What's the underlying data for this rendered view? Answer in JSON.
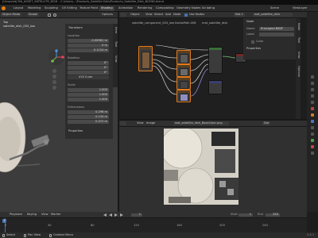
{
  "window": {
    "title": "[Unsaved] MA_ASSET_SATELLITE_DISH - C:\\Users\\...\\Products_Satellite Dish\\Products_Satellite_Dish_BLEND.blend"
  },
  "menubar": {
    "items": [
      "Layout",
      "Modeling",
      "Sculpting",
      "UV Editing",
      "Texture Paint",
      "Shading",
      "Animation",
      "Rendering",
      "Compositing",
      "Geometry Nodes",
      "Scripting"
    ],
    "active_index": 5,
    "scene_label": "Scene",
    "view_layer_label": "ViewLayer"
  },
  "viewport": {
    "mode": "Object Mode",
    "orientation": "Global",
    "view_label": "Top",
    "object_label": "satellite_dish_003_low",
    "options_label": "Options"
  },
  "n_panel": {
    "section_title": "Transform",
    "location_label": "Location",
    "location": {
      "x": "-0.08981 m",
      "y": "0 m",
      "z": "0.1154 m"
    },
    "rotation_label": "Rotation",
    "rotation": {
      "x": "0°",
      "y": "0°",
      "z": "0°"
    },
    "rotation_mode": "XYZ Euler",
    "scale_label": "Scale",
    "scale": {
      "x": "1.000",
      "y": "1.000",
      "z": "1.000"
    },
    "dimensions_label": "Dimensions",
    "dimensions": {
      "x": "0.296 m",
      "y": "0.134 m",
      "z": "0.372 m"
    },
    "properties_label": "Properties",
    "tabs": [
      "Item",
      "Tool",
      "View"
    ]
  },
  "node_editor": {
    "header_items": [
      "Object",
      "View",
      "Select",
      "Add",
      "Node"
    ],
    "use_nodes_label": "Use Nodes",
    "slot_label": "Slot 1",
    "material_name": "mat_satellite_dish",
    "breadcrumb": [
      "satellite_component_003_low",
      "NurbsPath.008",
      "mat_satellite_dish"
    ],
    "side_tabs": [
      "Node",
      "Tool",
      "View",
      "Options"
    ]
  },
  "node_sidebar": {
    "section_title": "Node",
    "name_label": "Name",
    "name_value": "Principled BSDF",
    "label_label": "Label",
    "label_value": "",
    "color_label": "Color",
    "properties_label": "Properties"
  },
  "image_editor": {
    "header_items": [
      "View",
      "Image"
    ],
    "image_name": "mat_satellite_dish_BaseColor.png",
    "slot_label": "Slot"
  },
  "timeline": {
    "playback_label": "Playback",
    "keying_label": "Keying",
    "view_label": "View",
    "marker_label": "Marker",
    "current_frame": "1",
    "start_label": "Start",
    "start_value": "1",
    "end_label": "End",
    "end_value": "250",
    "ticks": [
      "0",
      "40",
      "80",
      "120",
      "160",
      "200",
      "240"
    ]
  },
  "statusbar": {
    "left": "Select",
    "middle": "Pan View",
    "right": "Context Menu",
    "version": "3.6.1"
  },
  "colors": {
    "accent_orange": "#e07a1e",
    "header": "#303030",
    "panel": "#2b2b2b",
    "viewport_bg": "#3d3d3d"
  }
}
